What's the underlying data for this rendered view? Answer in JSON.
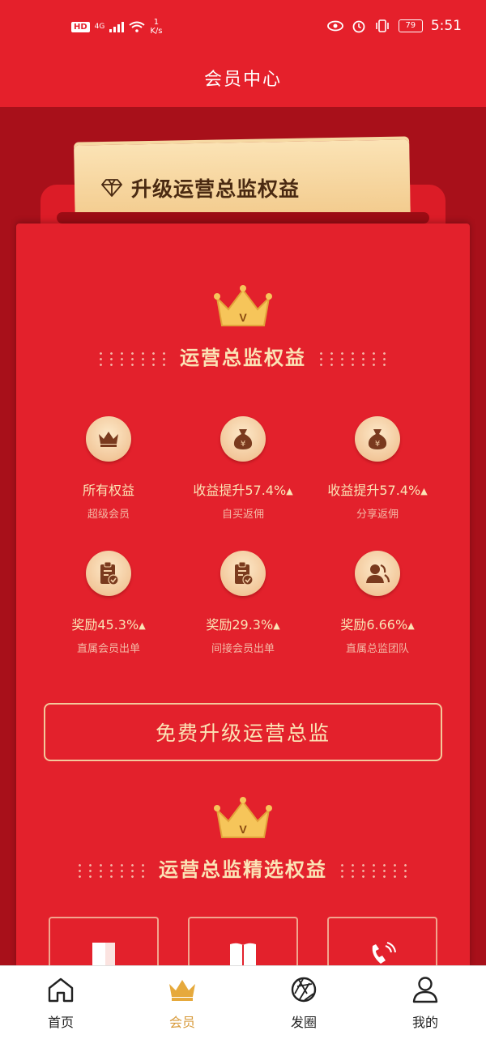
{
  "status_bar": {
    "hd": "HD",
    "network": "4G",
    "speed_value": "1",
    "speed_unit": "K/s",
    "battery": "79",
    "time": "5:51"
  },
  "header": {
    "title": "会员中心"
  },
  "ticket": {
    "text": "升级运营总监权益"
  },
  "section1": {
    "crown_letter": "V",
    "title": "运营总监权益"
  },
  "benefits": [
    {
      "icon": "crown-icon",
      "title": "所有权益",
      "arrow": false,
      "sub": "超级会员"
    },
    {
      "icon": "money-bag-icon",
      "title": "收益提升57.4%",
      "arrow": true,
      "sub": "自买返佣"
    },
    {
      "icon": "money-bag-icon",
      "title": "收益提升57.4%",
      "arrow": true,
      "sub": "分享返佣"
    },
    {
      "icon": "clipboard-check-icon",
      "title": "奖励45.3%",
      "arrow": true,
      "sub": "直属会员出单"
    },
    {
      "icon": "clipboard-check-icon",
      "title": "奖励29.3%",
      "arrow": true,
      "sub": "间接会员出单"
    },
    {
      "icon": "team-user-icon",
      "title": "奖励6.66%",
      "arrow": true,
      "sub": "直属总监团队"
    }
  ],
  "upgrade_button": {
    "label": "免费升级运营总监"
  },
  "section2": {
    "crown_letter": "V",
    "title": "运营总监精选权益"
  },
  "selected_cards": [
    {
      "icon": "door-icon"
    },
    {
      "icon": "book-icon"
    },
    {
      "icon": "phone-icon"
    }
  ],
  "tabbar": {
    "items": [
      {
        "label": "首页",
        "icon": "home-icon",
        "active": false
      },
      {
        "label": "会员",
        "icon": "crown-icon",
        "active": true
      },
      {
        "label": "发圈",
        "icon": "aperture-icon",
        "active": false
      },
      {
        "label": "我的",
        "icon": "user-icon",
        "active": false
      }
    ]
  },
  "colors": {
    "header_red": "#e5202b",
    "envelope_red": "#e3212c",
    "gold_text": "#fbe3b5",
    "active_tab": "#d89b3c"
  }
}
